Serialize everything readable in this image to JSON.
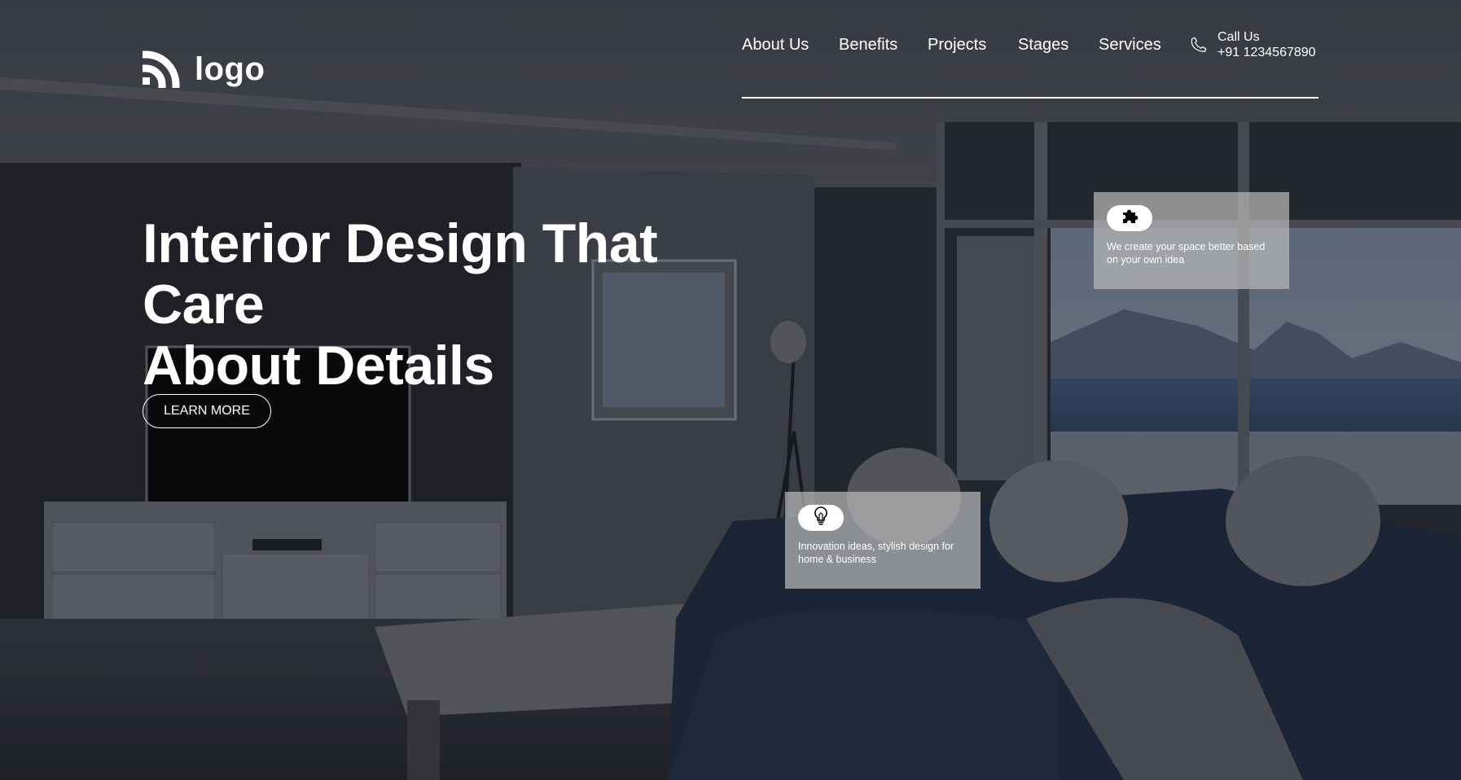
{
  "brand": {
    "logo_text": "logo",
    "logo_icon": "logo-arc-icon"
  },
  "nav": {
    "items": [
      {
        "label": "About Us"
      },
      {
        "label": "Benefits"
      },
      {
        "label": "Projects"
      },
      {
        "label": "Stages"
      },
      {
        "label": "Services"
      }
    ],
    "call": {
      "icon": "phone-icon",
      "label": "Call Us",
      "number": "+91 1234567890"
    }
  },
  "hero": {
    "headline_line1": "Interior Design That Care",
    "headline_line2": "About Details",
    "cta_label": "LEARN MORE"
  },
  "cards": [
    {
      "icon": "puzzle-icon",
      "text": "We create your space better based on your own idea"
    },
    {
      "icon": "lightbulb-icon",
      "text": "Innovation ideas, stylish design for home & business"
    }
  ],
  "colors": {
    "text": "#ffffff",
    "overlay": "#2a2d35",
    "card": "#b9b9b9"
  }
}
